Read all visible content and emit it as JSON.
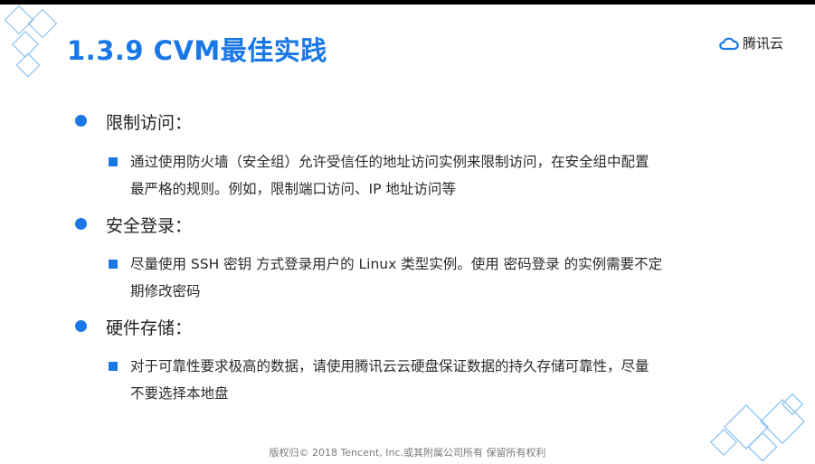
{
  "slide": {
    "title": "1.3.9 CVM最佳实践",
    "brand": {
      "logo_text": "腾讯云",
      "icon": "cloud-logo-icon",
      "accent_color": "#1a78e6"
    },
    "sections": [
      {
        "heading": "限制访问：",
        "detail_lines": [
          "通过使用防火墙（安全组）允许受信任的地址访问实例来限制访问，在安全组中配置",
          "最严格的规则。例如，限制端口访问、IP 地址访问等"
        ]
      },
      {
        "heading": "安全登录：",
        "detail_lines": [
          "尽量使用 SSH 密钥 方式登录用户的 Linux 类型实例。使用 密码登录 的实例需要不定",
          "期修改密码"
        ]
      },
      {
        "heading": "硬件存储：",
        "detail_lines": [
          "对于可靠性要求极高的数据，请使用腾讯云云硬盘保证数据的持久存储可靠性，尽量",
          "不要选择本地盘"
        ]
      }
    ],
    "footer": "版权归© 2018 Tencent, Inc.或其附属公司所有 保留所有权利"
  }
}
